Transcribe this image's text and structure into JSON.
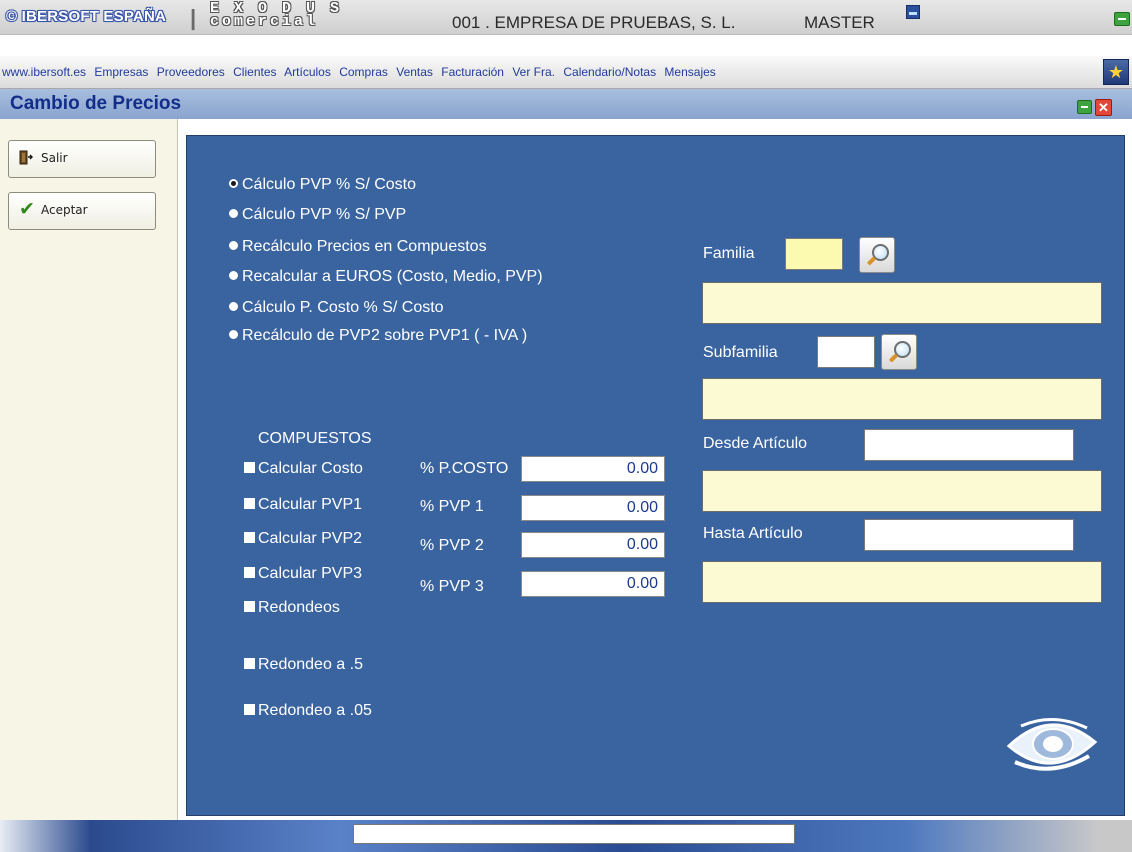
{
  "header": {
    "brand": "© IBERSOFT ESPAÑA",
    "separator": "|",
    "product_top": "E X O D U S",
    "product_bottom": "comercial",
    "company": "001 . EMPRESA DE PRUEBAS, S. L.",
    "user": "MASTER"
  },
  "menu": {
    "items": [
      "www.ibersoft.es",
      "Empresas",
      "Proveedores",
      "Clientes",
      "Artículos",
      "Compras",
      "Ventas",
      "Facturación",
      "Ver Fra.",
      "Calendario/Notas",
      "Mensajes"
    ]
  },
  "window": {
    "title": "Cambio de Precios",
    "close_glyph": "✕"
  },
  "sidebar": {
    "salir_label": "Salir",
    "aceptar_label": "Aceptar",
    "check_glyph": "✔"
  },
  "options": {
    "selected_index": 0,
    "items": [
      "Cálculo PVP % S/ Costo",
      "Cálculo PVP % S/ PVP",
      "Recálculo Precios en Compuestos",
      "Recalcular a EUROS (Costo, Medio, PVP)",
      "Cálculo P. Costo %  S/ Costo",
      "Recálculo de PVP2 sobre PVP1 ( - IVA )"
    ]
  },
  "compuestos": {
    "heading": "COMPUESTOS",
    "checks": [
      {
        "label": "Calcular Costo",
        "checked": false
      },
      {
        "label": "Calcular PVP1",
        "checked": false
      },
      {
        "label": "Calcular PVP2",
        "checked": false
      },
      {
        "label": "Calcular PVP3",
        "checked": false
      },
      {
        "label": "Redondeos",
        "checked": false
      },
      {
        "label": "Redondeo a .5",
        "checked": false
      },
      {
        "label": "Redondeo a .05",
        "checked": false
      }
    ],
    "percent_fields": [
      {
        "label": "% P.COSTO",
        "value": "0.00"
      },
      {
        "label": "% PVP 1",
        "value": "0.00"
      },
      {
        "label": "% PVP 2",
        "value": "0.00"
      },
      {
        "label": "% PVP 3",
        "value": "0.00"
      }
    ]
  },
  "filters": {
    "familia_label": "Familia",
    "subfamilia_label": "Subfamilia",
    "desde_label": "Desde Artículo",
    "hasta_label": "Hasta Artículo"
  },
  "colors": {
    "main_panel": "#3a64a0",
    "title_text": "#132d8a",
    "field_yellow": "#fcfad2"
  },
  "icons": {
    "salir": "exit-door-icon",
    "aceptar": "checkmark-icon",
    "search": "magnifier-icon",
    "eye": "eye-logo-icon",
    "star": "star-icon"
  }
}
